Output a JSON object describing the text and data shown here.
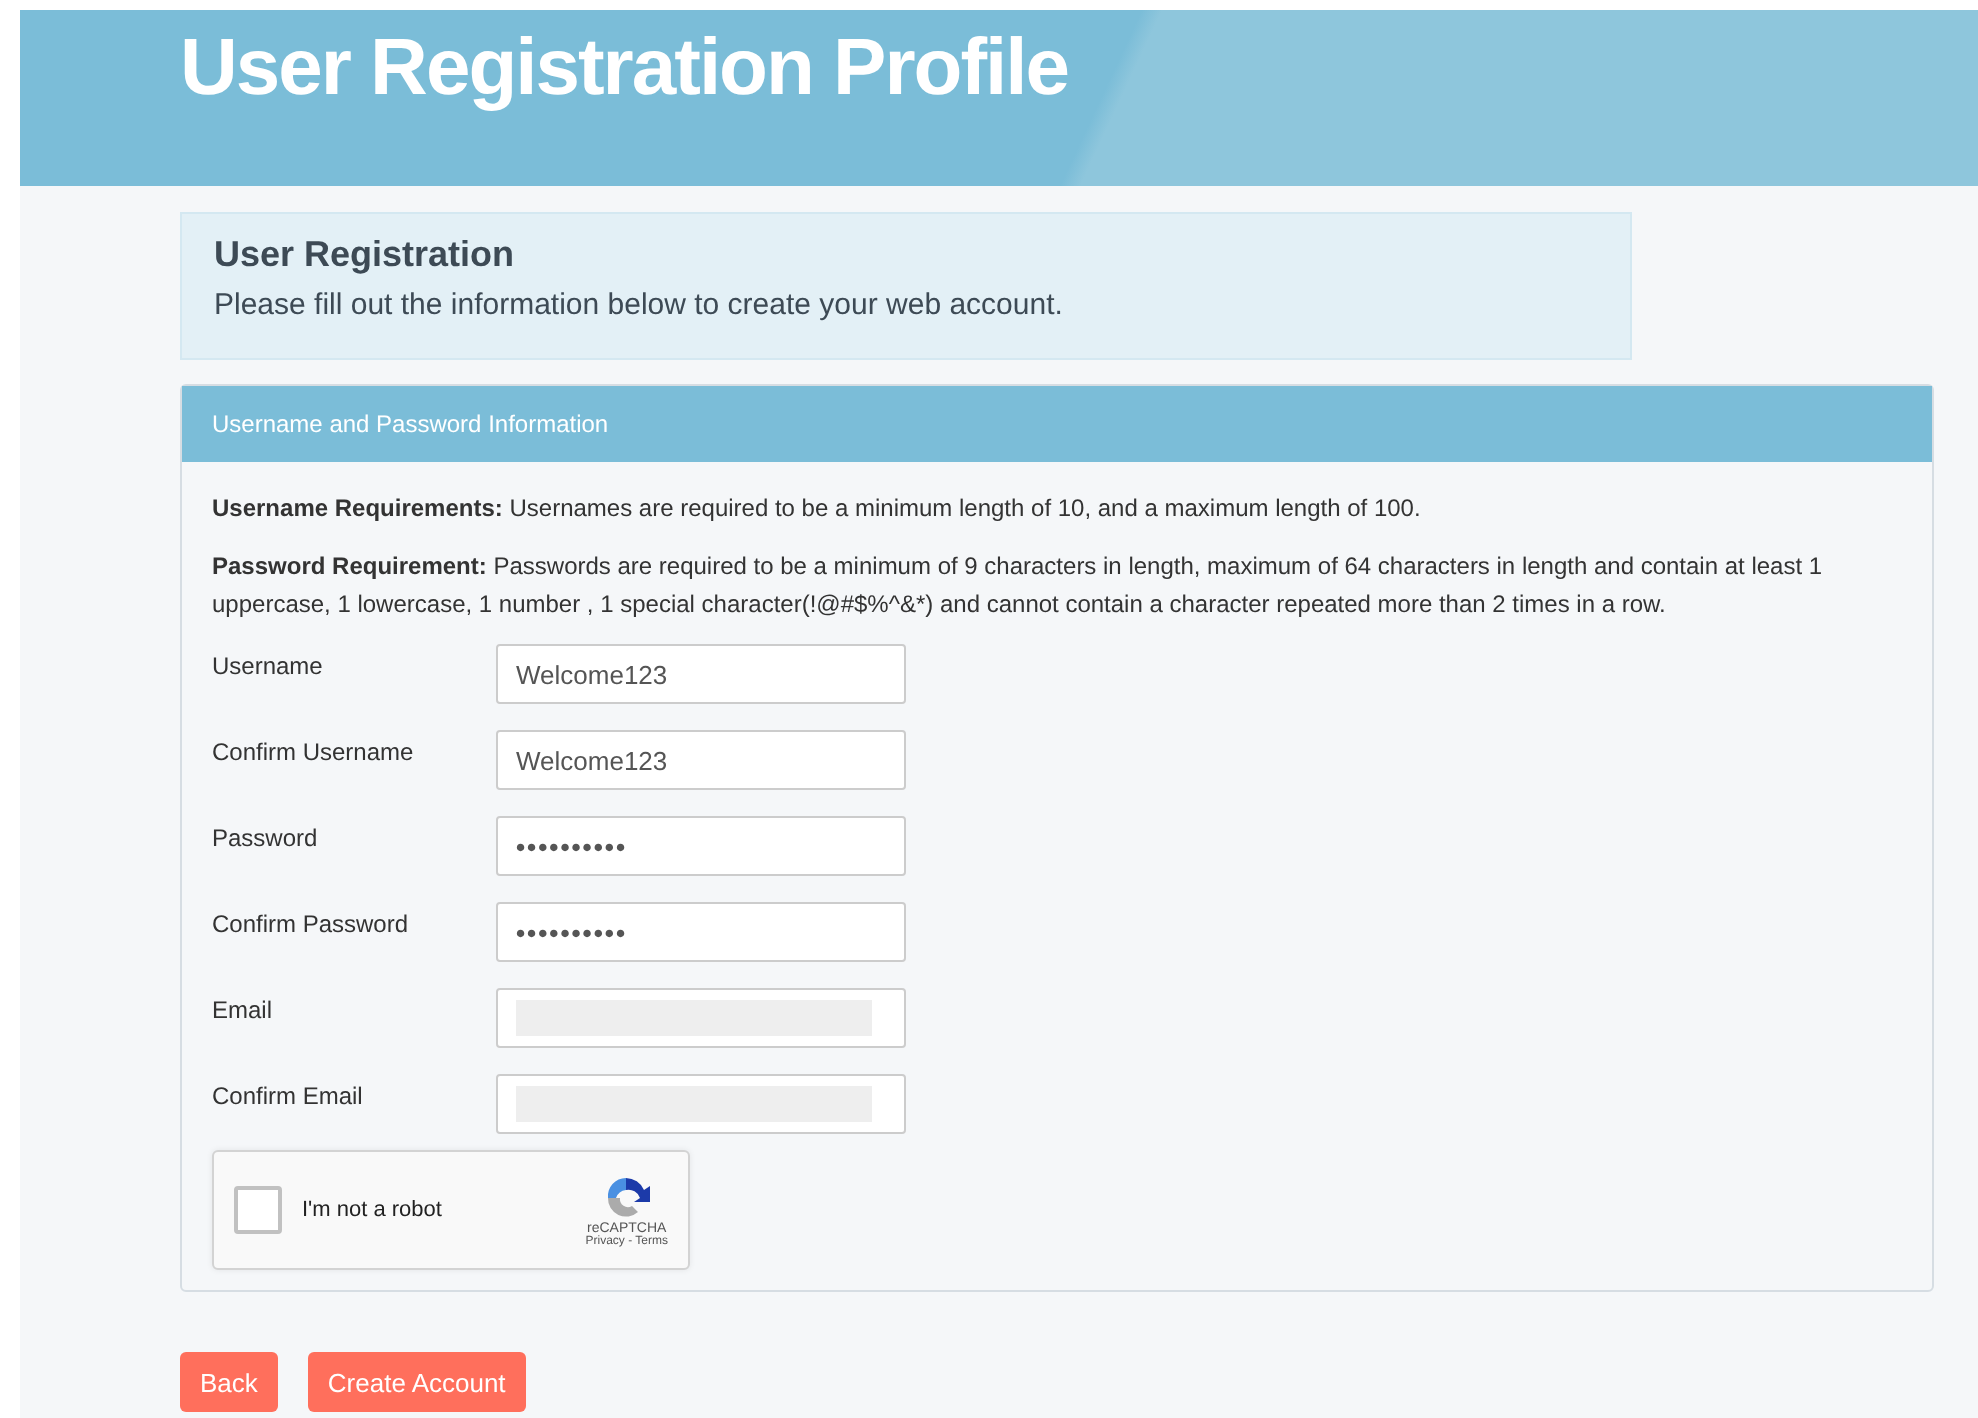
{
  "header": {
    "title": "User Registration Profile"
  },
  "intro": {
    "title": "User Registration",
    "text": "Please fill out the information below to create your web account."
  },
  "panel": {
    "title": "Username and Password Information",
    "requirements": [
      {
        "label": "Username Requirements:",
        "text": "Usernames are required to be a minimum length of 10, and a maximum length of 100."
      },
      {
        "label": "Password Requirement:",
        "text": "Passwords are required to be a minimum of 9 characters in length, maximum of 64 characters in length and contain at least 1 uppercase, 1 lowercase, 1 number , 1 special character(!@#$%^&*) and cannot contain a character repeated more than 2 times in a row."
      }
    ],
    "fields": [
      {
        "label": "Username",
        "value": "Welcome123",
        "kind": "text",
        "redacted": false
      },
      {
        "label": "Confirm Username",
        "value": "Welcome123",
        "kind": "text",
        "redacted": false
      },
      {
        "label": "Password",
        "value": "••••••••••",
        "kind": "password",
        "redacted": false
      },
      {
        "label": "Confirm Password",
        "value": "••••••••••",
        "kind": "password",
        "redacted": false
      },
      {
        "label": "Email",
        "kind": "text",
        "redacted": true
      },
      {
        "label": "Confirm Email",
        "kind": "text",
        "redacted": true
      }
    ],
    "captcha": {
      "label": "I'm not a robot",
      "checked": false,
      "brand": "reCAPTCHA",
      "links": "Privacy - Terms"
    }
  },
  "buttons": [
    {
      "label": "Back"
    },
    {
      "label": "Create Account"
    }
  ]
}
